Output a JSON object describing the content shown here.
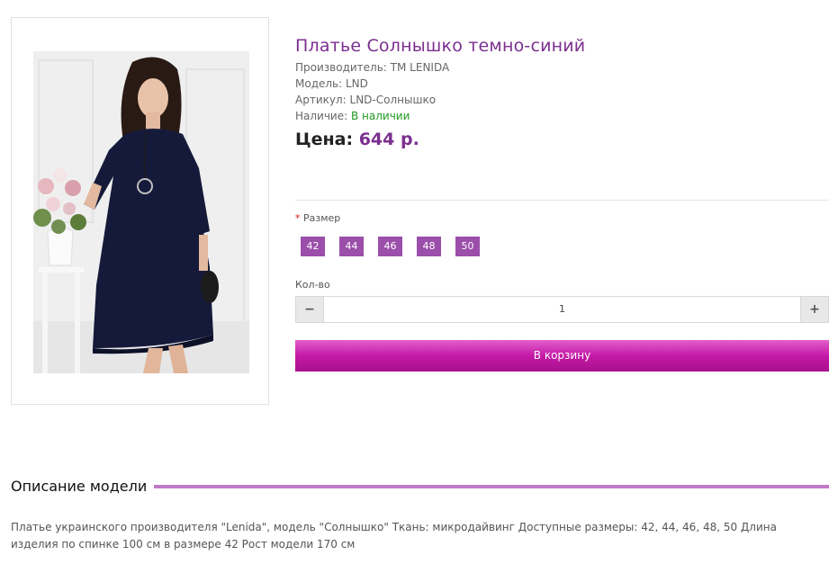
{
  "product": {
    "title": "Платье Солнышко темно-синий",
    "manufacturer_label": "Производитель:",
    "manufacturer": "TM LENIDA",
    "model_label": "Модель:",
    "model": "LND",
    "article_label": "Артикул:",
    "article": "LND-Солнышко",
    "availability_label": "Наличие:",
    "availability": "В наличии",
    "price_label": "Цена:",
    "price": "644 р."
  },
  "options": {
    "required_mark": "*",
    "size_label": "Размер",
    "sizes": [
      "42",
      "44",
      "46",
      "48",
      "50"
    ],
    "qty_label": "Кол-во",
    "qty_minus": "−",
    "qty_value": "1",
    "qty_plus": "+"
  },
  "cart": {
    "button_label": "В корзину"
  },
  "description": {
    "title": "Описание модели",
    "text": "Платье украинского производителя \"Lenida\", модель \"Солнышко\" Ткань: микродайвинг Доступные размеры: 42, 44, 46, 48, 50 Длина изделия по спинке 100 см в размере 42 Рост модели 170 см"
  },
  "colors": {
    "accent": "#7b2f8f",
    "size_button": "#9b4faa",
    "cart_button": "#c41aa6",
    "in_stock": "#1f9a1f",
    "divider": "#c07ac7"
  }
}
